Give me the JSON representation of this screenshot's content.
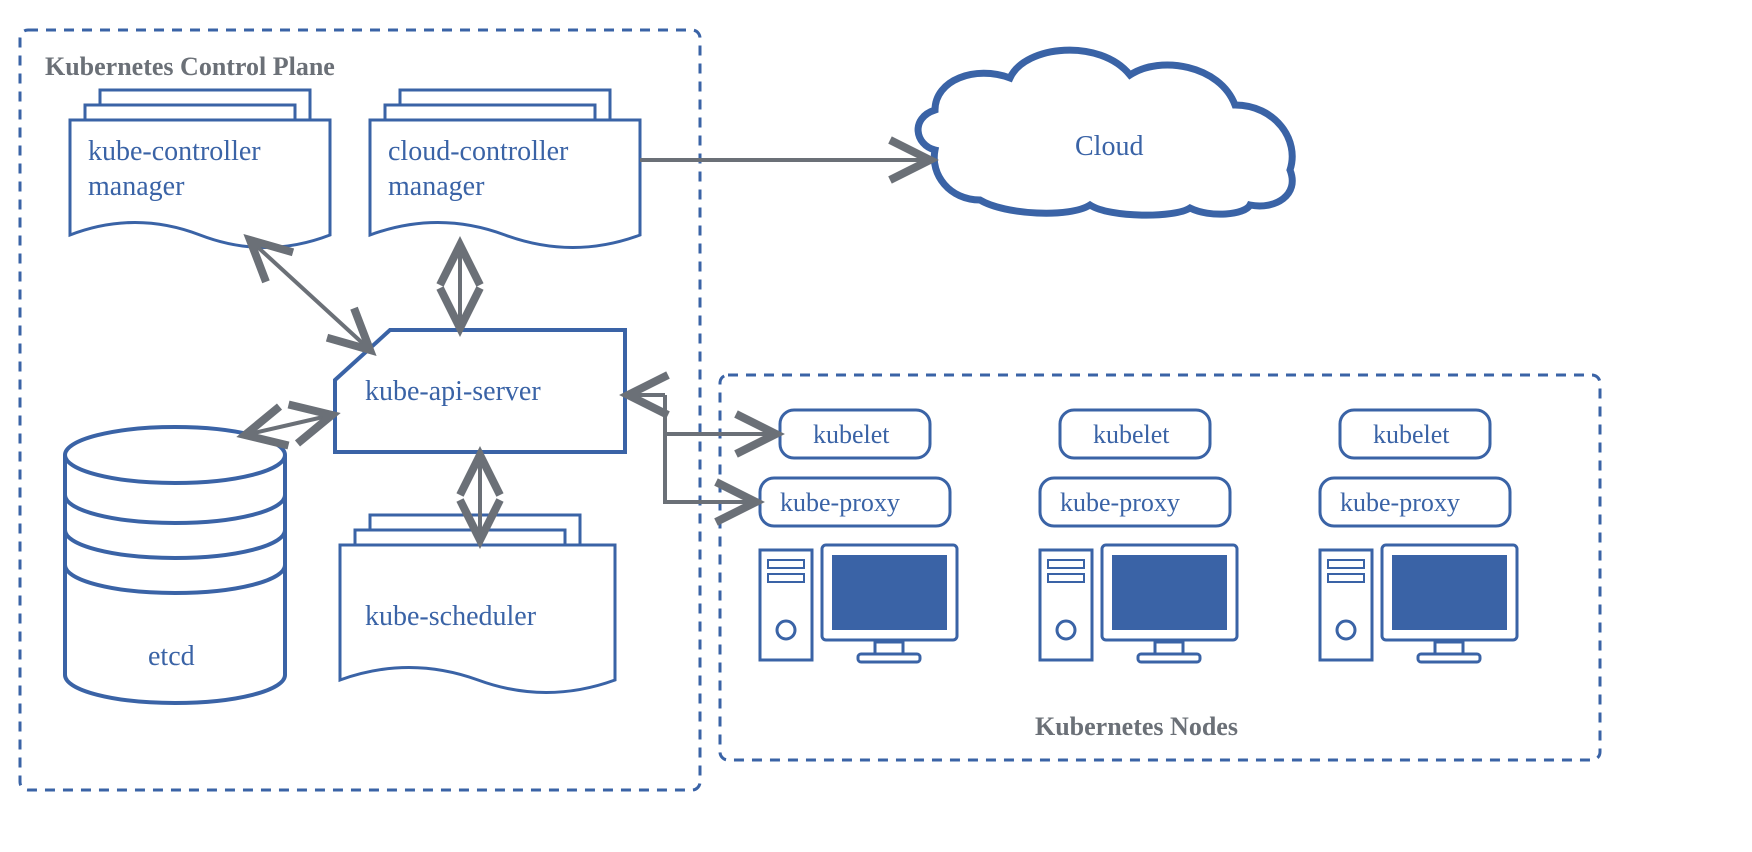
{
  "controlPlane": {
    "title": "Kubernetes Control Plane",
    "kubeControllerManager": {
      "line1": "kube-controller",
      "line2": "manager"
    },
    "cloudControllerManager": {
      "line1": "cloud-controller",
      "line2": "manager"
    },
    "kubeApiServer": "kube-api-server",
    "kubeScheduler": "kube-scheduler",
    "etcd": "etcd"
  },
  "cloud": {
    "label": "Cloud"
  },
  "nodes": {
    "title": "Kubernetes Nodes",
    "node1": {
      "kubelet": "kubelet",
      "kubeProxy": "kube-proxy"
    },
    "node2": {
      "kubelet": "kubelet",
      "kubeProxy": "kube-proxy"
    },
    "node3": {
      "kubelet": "kubelet",
      "kubeProxy": "kube-proxy"
    }
  },
  "colors": {
    "blue": "#3a63a6",
    "blueFill": "#3a63a6",
    "gray": "#6b7077",
    "dash": "#3a63a6"
  }
}
